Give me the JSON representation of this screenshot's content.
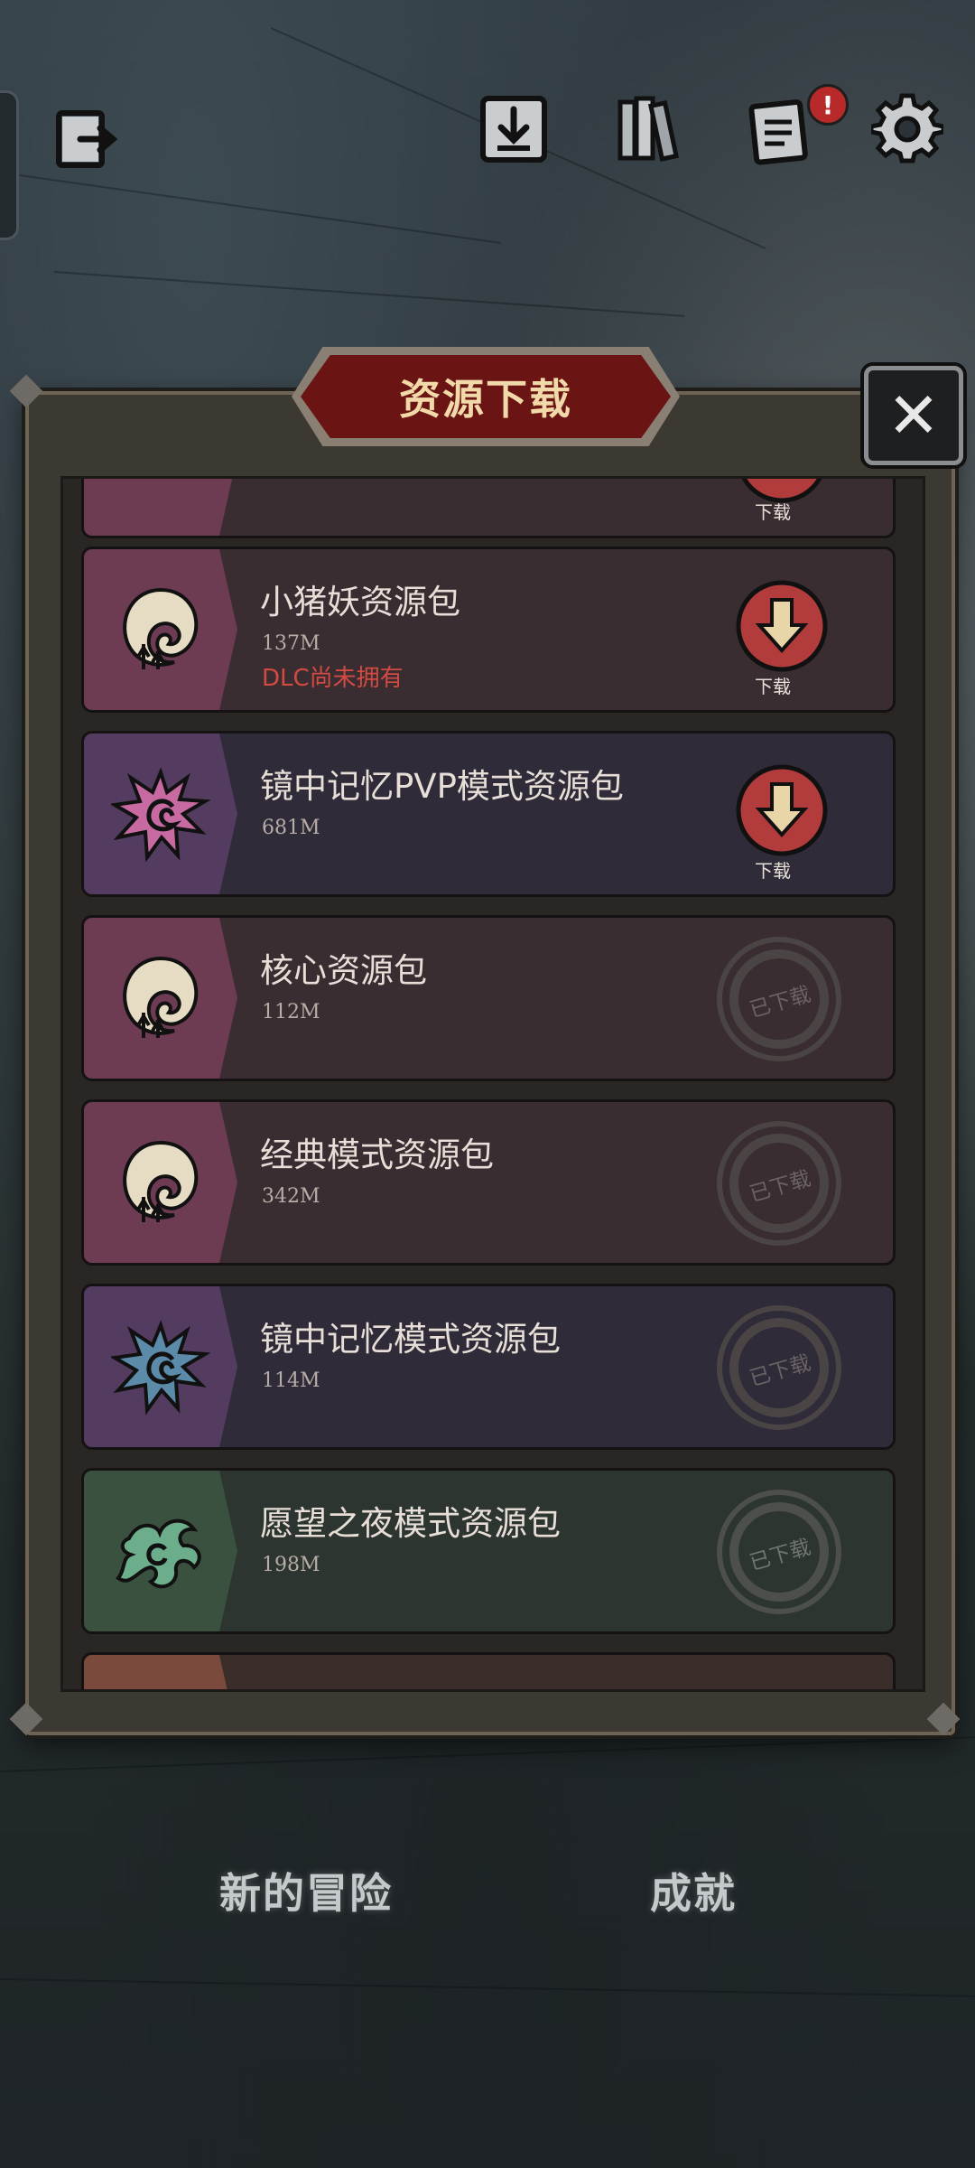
{
  "title": "资源下载",
  "close_label": "✕",
  "top_icons": {
    "exit": "exit-door-icon",
    "download": "download-box-icon",
    "books": "books-icon",
    "notes": "notes-icon",
    "notes_badge": "!",
    "settings": "gear-icon"
  },
  "packs": [
    {
      "name": "",
      "size": "",
      "status": "download",
      "status_label": "下载",
      "color": "pink"
    },
    {
      "name": "小猪妖资源包",
      "size": "137M",
      "note": "DLC尚未拥有",
      "status": "download",
      "status_label": "下载",
      "color": "pink"
    },
    {
      "name": "镜中记忆PVP模式资源包",
      "size": "681M",
      "status": "download",
      "status_label": "下载",
      "color": "purple"
    },
    {
      "name": "核心资源包",
      "size": "112M",
      "status": "downloaded",
      "status_label": "已下载",
      "color": "pink"
    },
    {
      "name": "经典模式资源包",
      "size": "342M",
      "status": "downloaded",
      "status_label": "已下载",
      "color": "pink"
    },
    {
      "name": "镜中记忆模式资源包",
      "size": "114M",
      "status": "downloaded",
      "status_label": "已下载",
      "color": "purple"
    },
    {
      "name": "愿望之夜模式资源包",
      "size": "198M",
      "status": "downloaded",
      "status_label": "已下载",
      "color": "green"
    }
  ],
  "bottom_nav": {
    "new_adventure": "新的冒险",
    "achievements": "成就"
  },
  "colors": {
    "title_banner": "#6b1414",
    "download_button": "#b23b3b",
    "dlc_warning": "#d24a42"
  }
}
